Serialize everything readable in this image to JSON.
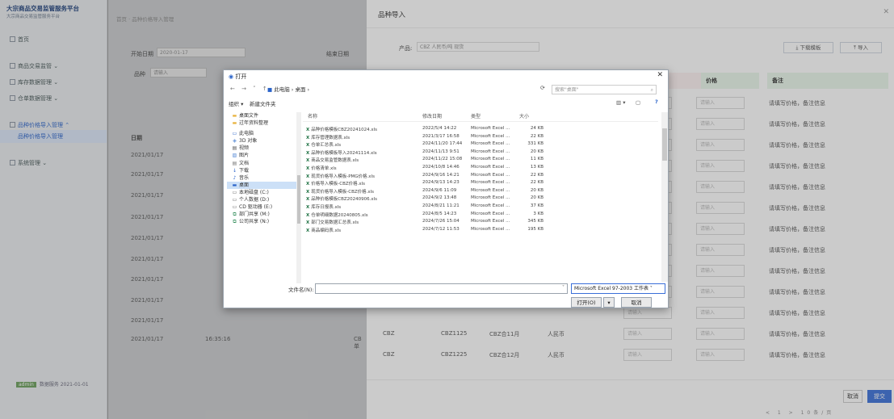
{
  "sidebar": {
    "logo_title": "大宗商品交易监管服务平台",
    "logo_subtitle": "大宗商品交易监管服务平台",
    "items": [
      "首页",
      "商品交易监管",
      "库存数据管理",
      "仓单数据管理",
      "品种价格导入管理",
      "品种价格导入管理",
      "系统管理"
    ],
    "footer_tag": "admin",
    "footer_text": "数据服务 2021-01-01"
  },
  "main": {
    "crumb": "首页 · 品种价格导入管理",
    "filter1_label": "开始日期",
    "filter1_value": "2020-01-17",
    "filter1_right": "结束日期",
    "filter2_label": "品种",
    "filter2_placeholder": "请输入",
    "table_header": "日期",
    "rows": [
      "2021/01/17",
      "2021/01/17",
      "2021/01/17",
      "2021/01/17",
      "2021/01/17",
      "2021/01/17",
      "2021/01/17",
      "2021/01/17",
      "2021/01/17",
      "2021/01/17"
    ],
    "last_row_extra": [
      "16:35:16",
      "CB单"
    ]
  },
  "drawer": {
    "title": "品种导入",
    "product_label": "产品:",
    "product_value": "CBZ 人民币/吨 现货",
    "btn_template": "下载模板",
    "btn_import": "导入",
    "col_price": "价格",
    "col_remark": "备注",
    "input_placeholder": "请输入",
    "remark_text": "请填写价格，备注信息",
    "rows": [
      {
        "code": "CBZ",
        "id": "CBZ1125",
        "name": "CBZ合11月",
        "currency": "人民币"
      },
      {
        "code": "CBZ",
        "id": "CBZ1225",
        "name": "CBZ合12月",
        "currency": "人民币"
      }
    ],
    "btn_cancel": "取消",
    "btn_submit": "提交",
    "pager": "< 1 > 10条/页"
  },
  "dialog": {
    "title": "打开",
    "path": "此电脑 › 桌面 ›",
    "search_placeholder": "搜索\"桌面\"",
    "organize": "组织 ▾",
    "new_folder": "新建文件夹",
    "nav_items": [
      {
        "icon": "folder",
        "label": "桌面文件"
      },
      {
        "icon": "folder",
        "label": "过年资料整理"
      },
      {
        "icon": "pc",
        "label": "此电脑"
      },
      {
        "icon": "obj",
        "label": "3D 对象"
      },
      {
        "icon": "video",
        "label": "视频"
      },
      {
        "icon": "pic",
        "label": "图片"
      },
      {
        "icon": "doc",
        "label": "文档"
      },
      {
        "icon": "down",
        "label": "下载"
      },
      {
        "icon": "music",
        "label": "音乐"
      },
      {
        "icon": "desk",
        "label": "桌面"
      },
      {
        "icon": "disk",
        "label": "本地磁盘 (C:)"
      },
      {
        "icon": "disk",
        "label": "个人数据 (D:)"
      },
      {
        "icon": "disk",
        "label": "CD 驱动器 (E:)"
      },
      {
        "icon": "net",
        "label": "部门共享 (M:)"
      },
      {
        "icon": "net",
        "label": "公司共享 (N:)"
      }
    ],
    "columns": [
      "名称",
      "修改日期",
      "类型",
      "大小"
    ],
    "files": [
      {
        "name": "品种价格模板CBZ20241024.xls",
        "date": "2022/5/4 14:22",
        "type": "Microsoft Excel ...",
        "size": "24 KB"
      },
      {
        "name": "库存管理数据表.xls",
        "date": "2021/3/17 16:58",
        "type": "Microsoft Excel ...",
        "size": "22 KB"
      },
      {
        "name": "仓单汇总表.xls",
        "date": "2024/11/20 17:44",
        "type": "Microsoft Excel ...",
        "size": "331 KB"
      },
      {
        "name": "品种价格模板导入20241114.xls",
        "date": "2024/11/13 9:51",
        "type": "Microsoft Excel ...",
        "size": "20 KB"
      },
      {
        "name": "商品交易监管数据表.xls",
        "date": "2024/11/22 15:08",
        "type": "Microsoft Excel ...",
        "size": "11 KB"
      },
      {
        "name": "价格清单.xls",
        "date": "2024/10/8 14:46",
        "type": "Microsoft Excel ...",
        "size": "13 KB"
      },
      {
        "name": "现货价格导入模板-PMG价格.xls",
        "date": "2024/9/16 14:21",
        "type": "Microsoft Excel ...",
        "size": "22 KB"
      },
      {
        "name": "价格导入模板-CBZ价格.xls",
        "date": "2024/9/13 14:23",
        "type": "Microsoft Excel ...",
        "size": "22 KB"
      },
      {
        "name": "现货价格导入模板-CBZ价格.xls",
        "date": "2024/9/6 11:09",
        "type": "Microsoft Excel ...",
        "size": "20 KB"
      },
      {
        "name": "品种价格模板CBZ20240906.xls",
        "date": "2024/9/2 13:48",
        "type": "Microsoft Excel ...",
        "size": "20 KB"
      },
      {
        "name": "库存日报表.xls",
        "date": "2024/8/21 11:21",
        "type": "Microsoft Excel ...",
        "size": "37 KB"
      },
      {
        "name": "仓单明细数据20240805.xls",
        "date": "2024/8/5 14:23",
        "type": "Microsoft Excel ...",
        "size": "3 KB"
      },
      {
        "name": "部门交易数据汇总表.xls",
        "date": "2024/7/26 15:04",
        "type": "Microsoft Excel ...",
        "size": "345 KB"
      },
      {
        "name": "商品编码表.xls",
        "date": "2024/7/12 11:53",
        "type": "Microsoft Excel ...",
        "size": "195 KB"
      }
    ],
    "filename_label": "文件名(N):",
    "filetype_value": "Microsoft Excel 97-2003 工作表",
    "btn_open": "打开(O)",
    "btn_cancel": "取消"
  }
}
